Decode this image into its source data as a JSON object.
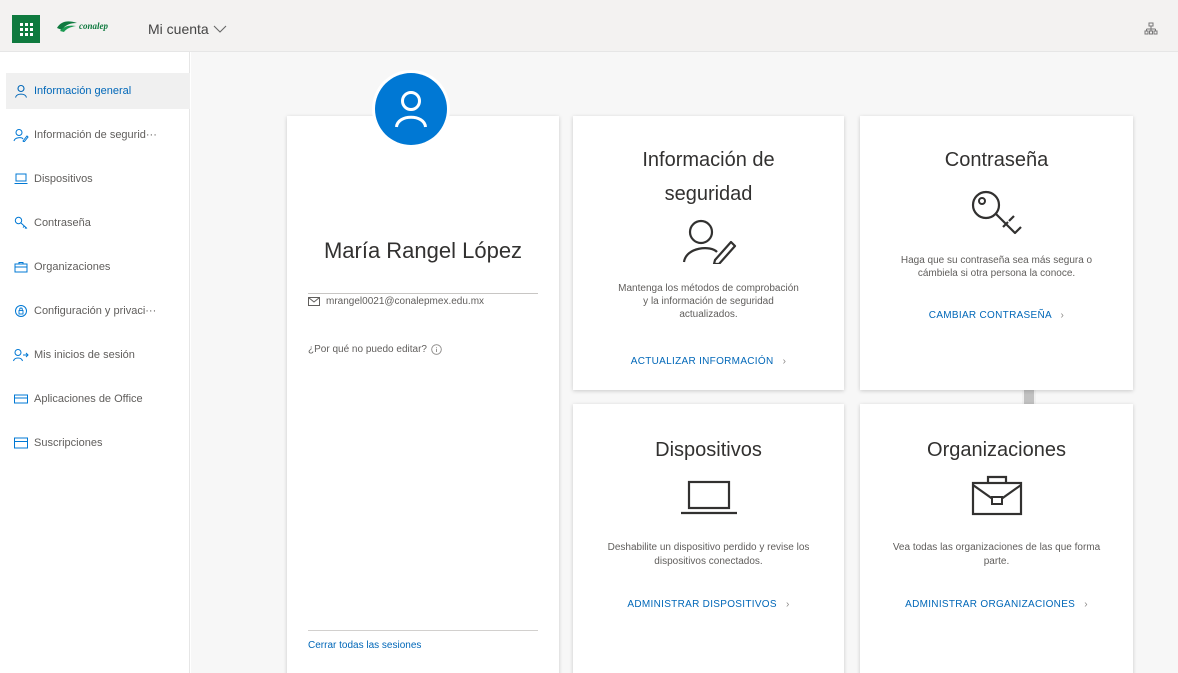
{
  "header": {
    "logo_text": "conalep",
    "account_label": "Mi cuenta",
    "colors": {
      "brand": "#0f7a3f",
      "accent": "#0078d4",
      "link": "#0067b8"
    }
  },
  "sidebar": {
    "items": [
      {
        "label": "Información general",
        "icon": "person-icon",
        "active": true
      },
      {
        "label": "Información de segurid···",
        "icon": "security-info-icon"
      },
      {
        "label": "Dispositivos",
        "icon": "laptop-icon"
      },
      {
        "label": "Contraseña",
        "icon": "key-icon"
      },
      {
        "label": "Organizaciones",
        "icon": "briefcase-icon"
      },
      {
        "label": "Configuración y privaci···",
        "icon": "lock-icon"
      },
      {
        "label": "Mis inicios de sesión",
        "icon": "sign-ins-icon"
      },
      {
        "label": "Aplicaciones de Office",
        "icon": "apps-icon"
      },
      {
        "label": "Suscripciones",
        "icon": "subscription-icon"
      }
    ]
  },
  "profile": {
    "name": "María Rangel López",
    "email": "mrangel0021@conalepmex.edu.mx",
    "why_cant_edit": "¿Por qué no puedo editar?",
    "sign_out_all": "Cerrar todas las sesiones"
  },
  "tiles": {
    "security": {
      "title_line1": "Información de",
      "title_line2": "seguridad",
      "desc_line1": "Mantenga los métodos de comprobación",
      "desc_line2": "y la información de seguridad",
      "desc_line3": "actualizados.",
      "action": "ACTUALIZAR INFORMACIÓN",
      "icon": "security-info-icon"
    },
    "password": {
      "title": "Contraseña",
      "desc_line1": "Haga que su contraseña sea más segura o",
      "desc_line2": "cámbiela si otra persona la conoce.",
      "action": "CAMBIAR CONTRASEÑA",
      "icon": "key-icon"
    },
    "devices": {
      "title": "Dispositivos",
      "desc_line1": "Deshabilite un dispositivo perdido y revise los",
      "desc_line2": "dispositivos conectados.",
      "action": "ADMINISTRAR DISPOSITIVOS",
      "icon": "laptop-icon"
    },
    "organizations": {
      "title": "Organizaciones",
      "desc_line1": "Vea todas las organizaciones de las que forma",
      "desc_line2": "parte.",
      "action": "ADMINISTRAR ORGANIZACIONES",
      "icon": "briefcase-icon"
    }
  }
}
